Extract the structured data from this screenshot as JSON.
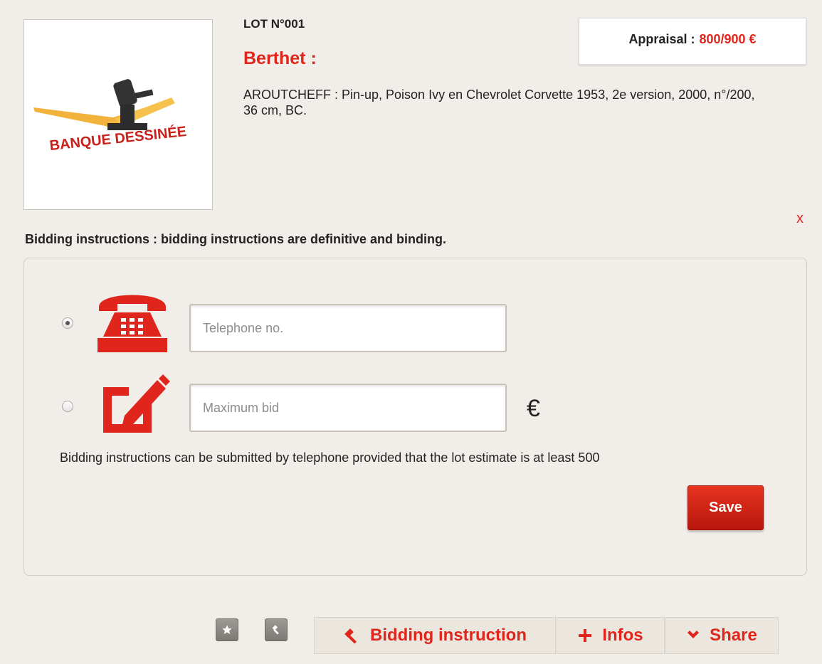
{
  "lot": {
    "number": "LOT N°001",
    "title": "Berthet :",
    "description": "AROUTCHEFF : Pin-up, Poison Ivy en Chevrolet Corvette 1953, 2e version, 2000, n°/200, 36 cm, BC.",
    "image_logo_text": "BANQUE DESSINÉE"
  },
  "appraisal": {
    "label": "Appraisal :",
    "value": "800/900 €"
  },
  "close_label": "x",
  "bidding": {
    "heading": "Bidding instructions : bidding instructions are definitive and binding.",
    "phone_placeholder": "Telephone no.",
    "bid_placeholder": "Maximum bid",
    "currency": "€",
    "note": "Bidding instructions can be submitted by telephone provided that the lot estimate is at least 500",
    "save_label": "Save",
    "selected_option": "telephone"
  },
  "actions": {
    "favorite_icon": "star-icon",
    "bid_icon": "gavel-icon",
    "tabs": [
      {
        "label": "Bidding instruction",
        "icon": "gavel-icon"
      },
      {
        "label": "Infos",
        "icon": "plus-icon"
      },
      {
        "label": "Share",
        "icon": "chevron-down-icon"
      }
    ]
  },
  "colors": {
    "accent": "#e0261c",
    "background": "#f1eeea",
    "tab_background": "#ebe7df"
  }
}
